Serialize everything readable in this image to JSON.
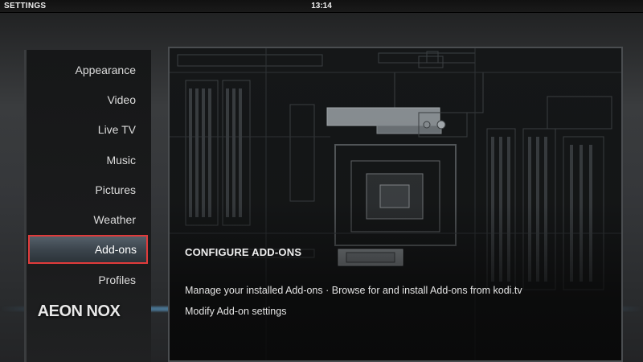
{
  "header": {
    "title": "SETTINGS",
    "clock": "13:14"
  },
  "sidebar": {
    "items": [
      {
        "label": "Appearance"
      },
      {
        "label": "Video"
      },
      {
        "label": "Live TV"
      },
      {
        "label": "Music"
      },
      {
        "label": "Pictures"
      },
      {
        "label": "Weather"
      },
      {
        "label": "Add-ons",
        "selected": true
      },
      {
        "label": "Profiles"
      }
    ],
    "logo": "AEON NOX"
  },
  "info": {
    "title": "CONFIGURE ADD-ONS",
    "line1": "Manage your installed Add-ons · Browse for and install Add-ons from kodi.tv",
    "line2": "Modify Add-on settings"
  },
  "colors": {
    "selection_border": "#e03b3b",
    "text": "#e6e6e6"
  }
}
